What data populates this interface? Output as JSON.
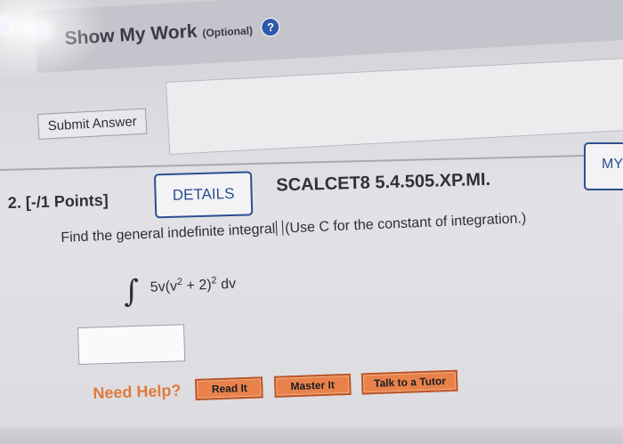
{
  "work": {
    "title": "Show My Work",
    "optional": "(Optional)",
    "help_glyph": "?",
    "submit_label": "Submit Answer"
  },
  "question": {
    "number_label": "2. [-/1 Points]",
    "details_label": "DETAILS",
    "code": "SCALCET8 5.4.505.XP.MI.",
    "my_label": "MY",
    "prompt_before": "Find the general indefinite integral",
    "prompt_after": "(Use C for the constant of integration.)",
    "integrand_base": "5v(v",
    "integrand_exp1": "2",
    "integrand_mid": " + 2)",
    "integrand_exp2": "2",
    "integrand_dv": " dv",
    "answer_value": ""
  },
  "help": {
    "label": "Need Help?",
    "read_it": "Read It",
    "master_it": "Master It",
    "talk_tutor": "Talk to a Tutor"
  },
  "colors": {
    "accent_blue": "#2c4f8f",
    "help_orange": "#e9824a",
    "need_help_text": "#e07a3c"
  },
  "icons": {
    "help": "question-circle-icon",
    "cursor": "text-cursor-icon",
    "integral": "integral-sign"
  }
}
